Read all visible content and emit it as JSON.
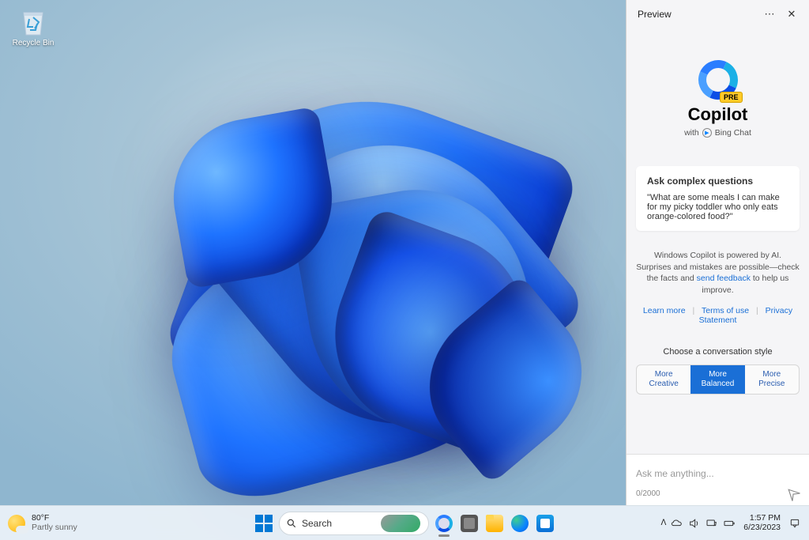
{
  "desktop": {
    "recycle_bin": "Recycle Bin"
  },
  "copilot": {
    "header": "Preview",
    "name": "Copilot",
    "with": "with",
    "bing": "Bing Chat",
    "card": {
      "title": "Ask complex questions",
      "example": "\"What are some meals I can make for my picky toddler who only eats orange-colored food?\""
    },
    "disclaimer_pre": "Windows Copilot is powered by AI. Surprises and mistakes are possible—check the facts and ",
    "disclaimer_link": "send feedback",
    "disclaimer_post": " to help us improve.",
    "links": {
      "learn": "Learn more",
      "terms": "Terms of use",
      "privacy": "Privacy Statement"
    },
    "style_label": "Choose a conversation style",
    "styles": {
      "creative_more": "More",
      "creative": "Creative",
      "balanced_more": "More",
      "balanced": "Balanced",
      "precise_more": "More",
      "precise": "Precise"
    },
    "input_placeholder": "Ask me anything...",
    "counter": "0/2000"
  },
  "taskbar": {
    "temp": "80°F",
    "weather": "Partly sunny",
    "search": "Search",
    "time": "1:57 PM",
    "date": "6/23/2023"
  }
}
